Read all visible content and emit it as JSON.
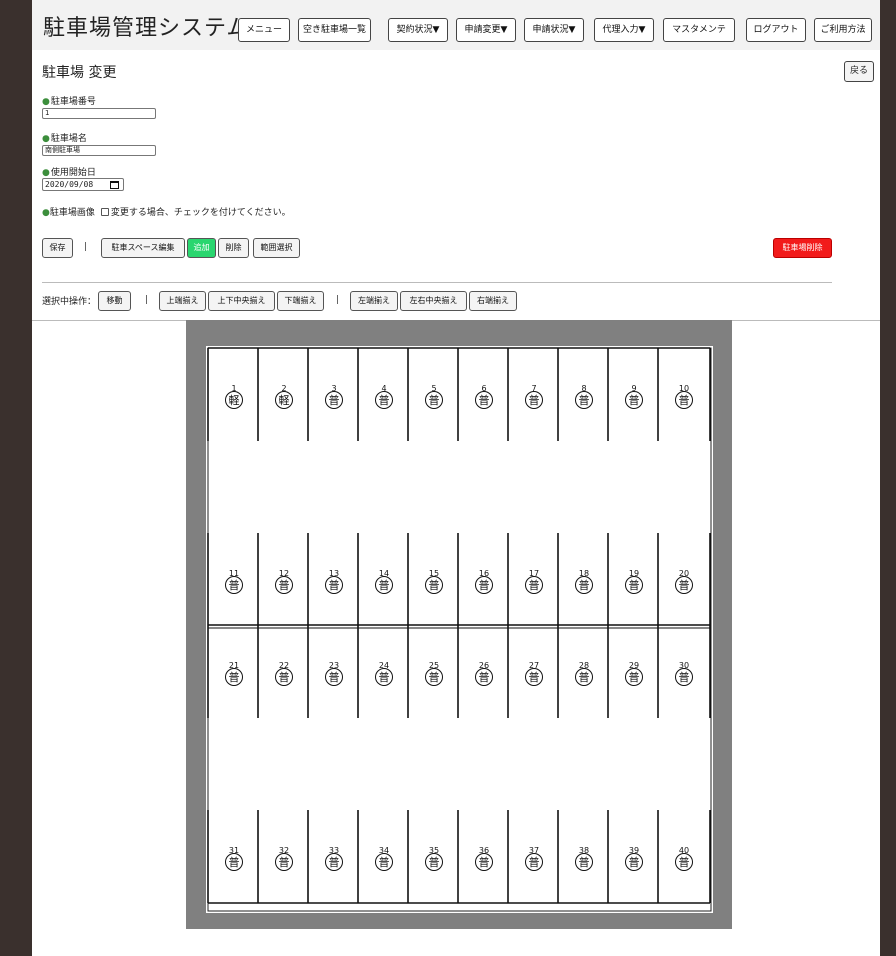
{
  "header": {
    "title": "駐車場管理システム",
    "nav": [
      "メニュー",
      "空き駐車場一覧",
      "契約状況▼",
      "申請変更▼",
      "申請状況▼",
      "代理入力▼",
      "マスタメンテ",
      "ログアウト",
      "ご利用方法"
    ]
  },
  "page_title": "駐車場 変更",
  "back_label": "戻る",
  "form": {
    "lot_number_label": "駐車場番号",
    "lot_number_value": "1",
    "lot_name_label": "駐車場名",
    "lot_name_value": "南側駐車場",
    "start_date_label": "使用開始日",
    "start_date_value": "2020/09/08",
    "image_label": "駐車場画像",
    "image_check_label": "変更する場合、チェックを付けてください。",
    "required_marker": "●"
  },
  "toolbar": {
    "save": "保存",
    "separator": "|",
    "edit_spaces": "駐車スペース編集",
    "add": "追加",
    "delete": "削除",
    "range_select": "範囲選択",
    "delete_lot": "駐車場削除"
  },
  "selection_ops": {
    "label": "選択中操作：",
    "move": "移動",
    "align_top": "上端揃え",
    "align_vcenter": "上下中央揃え",
    "align_bottom": "下端揃え",
    "align_left": "左端揃え",
    "align_hcenter": "左右中央揃え",
    "align_right": "右端揃え"
  },
  "spaces": [
    {
      "no": "1",
      "type": "軽"
    },
    {
      "no": "2",
      "type": "軽"
    },
    {
      "no": "3",
      "type": "普"
    },
    {
      "no": "4",
      "type": "普"
    },
    {
      "no": "5",
      "type": "普"
    },
    {
      "no": "6",
      "type": "普"
    },
    {
      "no": "7",
      "type": "普"
    },
    {
      "no": "8",
      "type": "普"
    },
    {
      "no": "9",
      "type": "普"
    },
    {
      "no": "10",
      "type": "普"
    },
    {
      "no": "11",
      "type": "普"
    },
    {
      "no": "12",
      "type": "普"
    },
    {
      "no": "13",
      "type": "普"
    },
    {
      "no": "14",
      "type": "普"
    },
    {
      "no": "15",
      "type": "普"
    },
    {
      "no": "16",
      "type": "普"
    },
    {
      "no": "17",
      "type": "普"
    },
    {
      "no": "18",
      "type": "普"
    },
    {
      "no": "19",
      "type": "普"
    },
    {
      "no": "20",
      "type": "普"
    },
    {
      "no": "21",
      "type": "普"
    },
    {
      "no": "22",
      "type": "普"
    },
    {
      "no": "23",
      "type": "普"
    },
    {
      "no": "24",
      "type": "普"
    },
    {
      "no": "25",
      "type": "普"
    },
    {
      "no": "26",
      "type": "普"
    },
    {
      "no": "27",
      "type": "普"
    },
    {
      "no": "28",
      "type": "普"
    },
    {
      "no": "29",
      "type": "普"
    },
    {
      "no": "30",
      "type": "普"
    },
    {
      "no": "31",
      "type": "普"
    },
    {
      "no": "32",
      "type": "普"
    },
    {
      "no": "33",
      "type": "普"
    },
    {
      "no": "34",
      "type": "普"
    },
    {
      "no": "35",
      "type": "普"
    },
    {
      "no": "36",
      "type": "普"
    },
    {
      "no": "37",
      "type": "普"
    },
    {
      "no": "38",
      "type": "普"
    },
    {
      "no": "39",
      "type": "普"
    },
    {
      "no": "40",
      "type": "普"
    }
  ],
  "colors": {
    "frame": "#3a302d",
    "add_button": "#2ad66f",
    "delete_lot_button": "#f21b1b",
    "map_border": "#808080",
    "required_dot": "#3c8e3c"
  }
}
